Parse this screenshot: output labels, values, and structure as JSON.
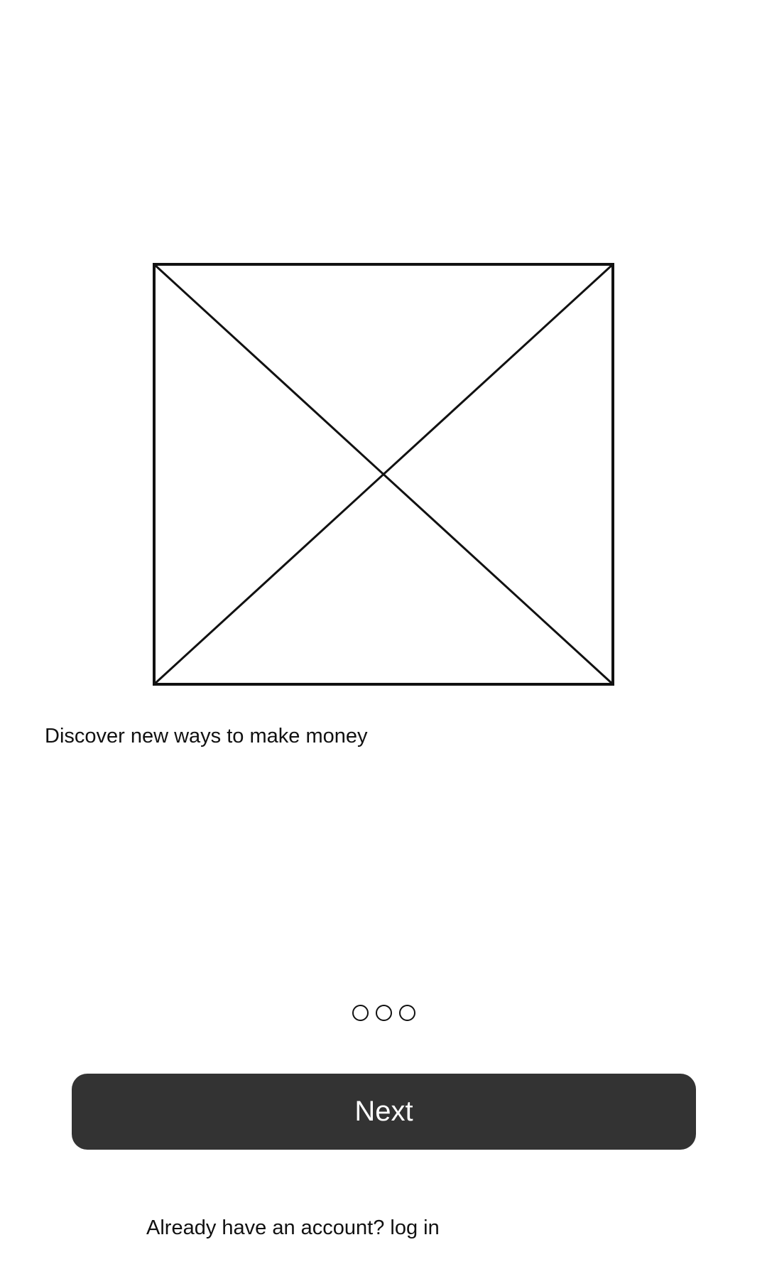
{
  "onboarding": {
    "hero_image": {
      "icon": "image-placeholder-icon"
    },
    "headline": "Discover new ways to make money",
    "pagination": {
      "total_pages": 3
    },
    "next_button_label": "Next",
    "login_prompt": {
      "text": "Already have an account?",
      "link_label": "log in"
    }
  },
  "colors": {
    "button_background": "#333333",
    "button_text": "#ffffff",
    "text": "#111111",
    "background": "#ffffff"
  }
}
